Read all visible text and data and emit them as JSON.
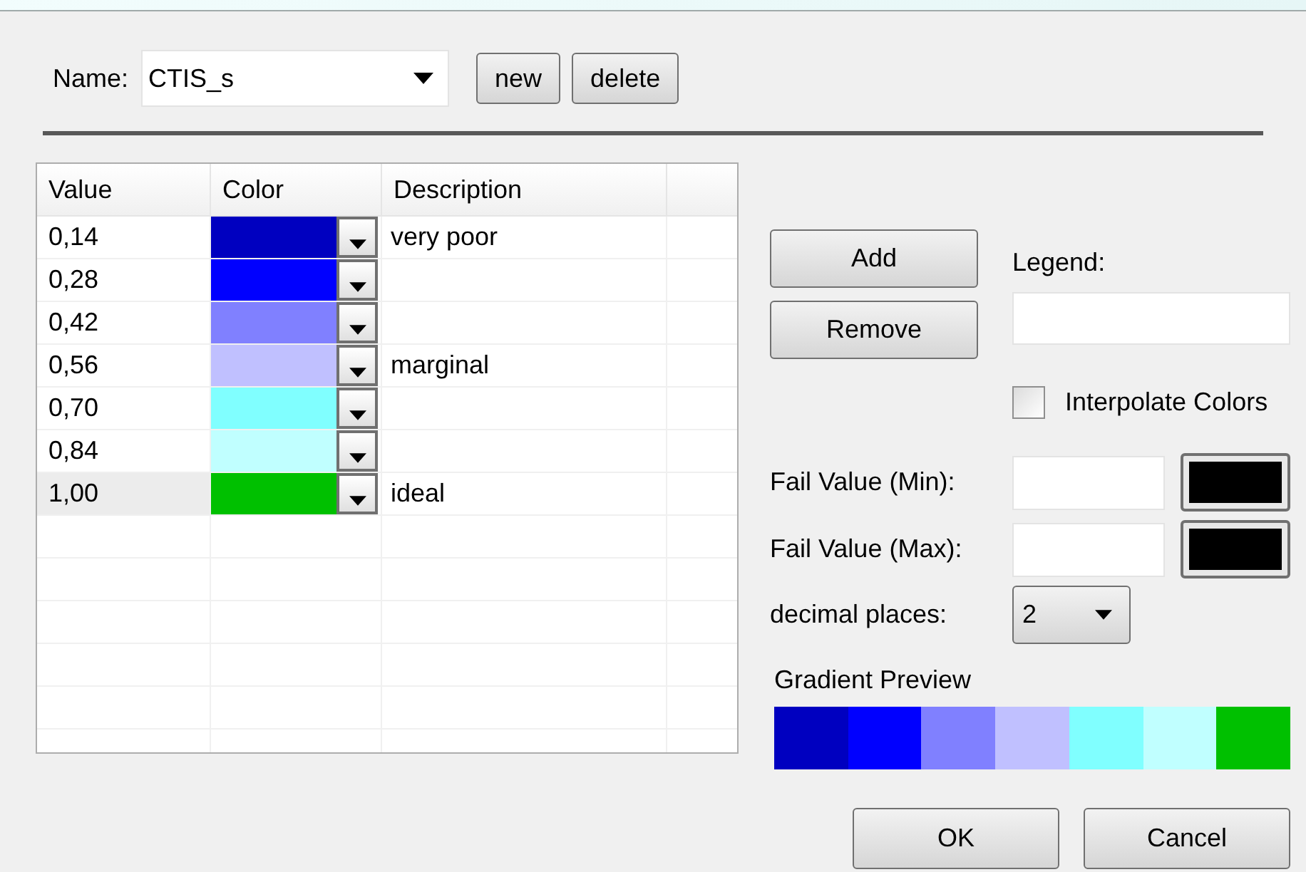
{
  "name_field": {
    "label": "Name:",
    "value": "CTIS_s"
  },
  "top_buttons": [
    "new",
    "delete"
  ],
  "table": {
    "columns": [
      "Value",
      "Color",
      "Description"
    ],
    "rows": [
      {
        "value": "0,14",
        "color": "#0000c0",
        "description": "very poor",
        "selected": false
      },
      {
        "value": "0,28",
        "color": "#0000ff",
        "selected": false
      },
      {
        "value": "0,42",
        "color": "#8080ff",
        "selected": false
      },
      {
        "value": "0,56",
        "color": "#c0c0ff",
        "description": "marginal",
        "selected": false
      },
      {
        "value": "0,70",
        "color": "#80ffff",
        "selected": false
      },
      {
        "value": "0,84",
        "color": "#c0ffff",
        "selected": false
      },
      {
        "value": "1,00",
        "color": "#00c000",
        "description": "ideal",
        "selected": true
      }
    ]
  },
  "row_buttons": [
    "Add",
    "Remove"
  ],
  "legend": {
    "label": "Legend:"
  },
  "interpolate": {
    "label": "Interpolate Colors",
    "checked": false
  },
  "fail_values": [
    {
      "label": "Fail Value (Min):",
      "color": "#000000"
    },
    {
      "label": "Fail Value (Max):",
      "color": "#000000"
    }
  ],
  "decimal_places": {
    "label": "decimal places:",
    "value": "2"
  },
  "gradient_preview": {
    "label": "Gradient Preview"
  },
  "dialog_buttons": [
    "OK",
    "Cancel"
  ]
}
